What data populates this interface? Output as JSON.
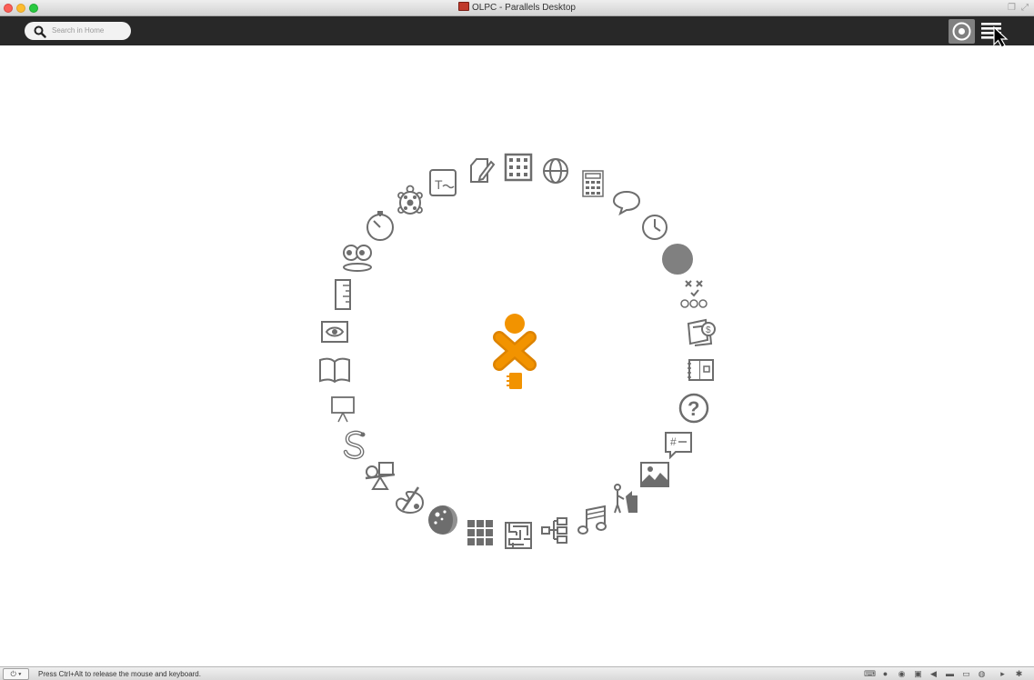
{
  "window": {
    "title": "OLPC - Parallels Desktop"
  },
  "toolbar": {
    "search_placeholder": "Search in Home"
  },
  "home": {
    "activities": [
      "text-editor-icon",
      "write-icon",
      "abacus-icon",
      "browse-icon",
      "calculate-icon",
      "chat-icon",
      "clock-icon",
      "turtle-icon",
      "stopwatch-icon",
      "eyes-icon",
      "measure-icon",
      "view-slides-icon",
      "read-icon",
      "portfolio-icon",
      "pippy-icon",
      "physics-icon",
      "paint-icon",
      "moon-icon",
      "memorize-icon",
      "maze-icon",
      "labyrinth-icon",
      "music-icon",
      "record-icon",
      "image-viewer-icon",
      "irc-chat-icon",
      "help-icon",
      "log-icon",
      "finance-icon",
      "tic-tac-toe-icon",
      "circle-icon"
    ],
    "accent": "#f29300"
  },
  "statusbar": {
    "message": "Press Ctrl+Alt to release the mouse and keyboard."
  }
}
